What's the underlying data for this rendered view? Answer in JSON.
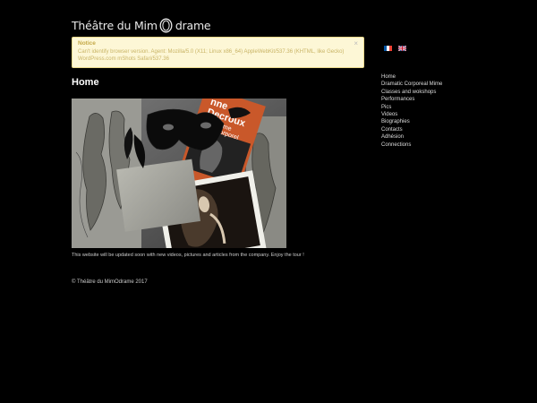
{
  "site": {
    "title_before": "Théâtre du Mim",
    "title_after": "drame"
  },
  "notice": {
    "title": "Notice",
    "text": "Can't identify browser version. Agent: Mozilla/5.0 (X11; Linux x86_64) AppleWebKit/537.36 (KHTML, like Gecko) WordPress.com mShots Safari/537.36",
    "close_glyph": "×"
  },
  "languages": [
    {
      "icon": "french-flag-icon",
      "colors": [
        "#0055a4",
        "#ffffff",
        "#ef4135"
      ]
    },
    {
      "icon": "uk-flag-icon",
      "colors": [
        "#012169",
        "#ffffff",
        "#c8102e"
      ]
    }
  ],
  "page": {
    "title": "Home",
    "caption": "This website will be updated soon with new videos, pictures and articles from the company. Enjoy the tour !"
  },
  "photo": {
    "book_text_1": "nne",
    "book_text_2": "Decroux",
    "book_text_3": "ime",
    "book_text_4": "orporel"
  },
  "nav": {
    "items": [
      "Home",
      "Dramatic Corporeal Mime",
      "Classes and wokshops",
      "Performances",
      "Pics",
      "Videos",
      "Biographies",
      "Contacts",
      "Adhésion",
      "Connections"
    ]
  },
  "footer": {
    "text": "© Théâtre du MimOdrame 2017"
  },
  "colors": {
    "background": "#000000",
    "notice_bg": "#fdf7d6",
    "notice_border": "#e9d98a",
    "notice_text": "#c4a948"
  }
}
